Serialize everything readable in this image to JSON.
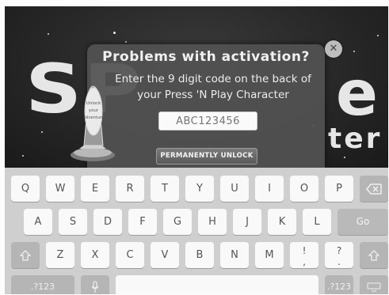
{
  "background": {
    "logo_left_text": "SP",
    "logo_right_text": "e",
    "logo_sub_text": "ter"
  },
  "dialog": {
    "title": "Problems with activation?",
    "message": "Enter the 9 digit code on the back of your Press 'N Play Character",
    "code_placeholder": "ABC123456",
    "unlock_button_label": "PERMANENTLY UNLOCK",
    "close_icon": "close-icon"
  },
  "character": {
    "banner_text": "Unlock your Adventure"
  },
  "keyboard": {
    "row1": [
      "Q",
      "W",
      "E",
      "R",
      "T",
      "Y",
      "U",
      "I",
      "O",
      "P"
    ],
    "row2": [
      "A",
      "S",
      "D",
      "F",
      "G",
      "H",
      "J",
      "K",
      "L"
    ],
    "row3": [
      "Z",
      "X",
      "C",
      "V",
      "B",
      "N",
      "M"
    ],
    "go_label": "Go",
    "numbers_left_label": ".?123",
    "numbers_right_label": ".?123",
    "exclaim_top": "!",
    "exclaim_bottom": ",",
    "question_top": "?",
    "question_bottom": ".",
    "icons": {
      "backspace": "backspace-icon",
      "shift_left": "shift-icon",
      "shift_right": "shift-icon",
      "mic": "microphone-icon",
      "hide_keyboard": "hide-keyboard-icon"
    },
    "colors": {
      "key": "#f9f9f9",
      "key_dark": "#b5b5b5",
      "board": "#cfcfcf"
    }
  }
}
